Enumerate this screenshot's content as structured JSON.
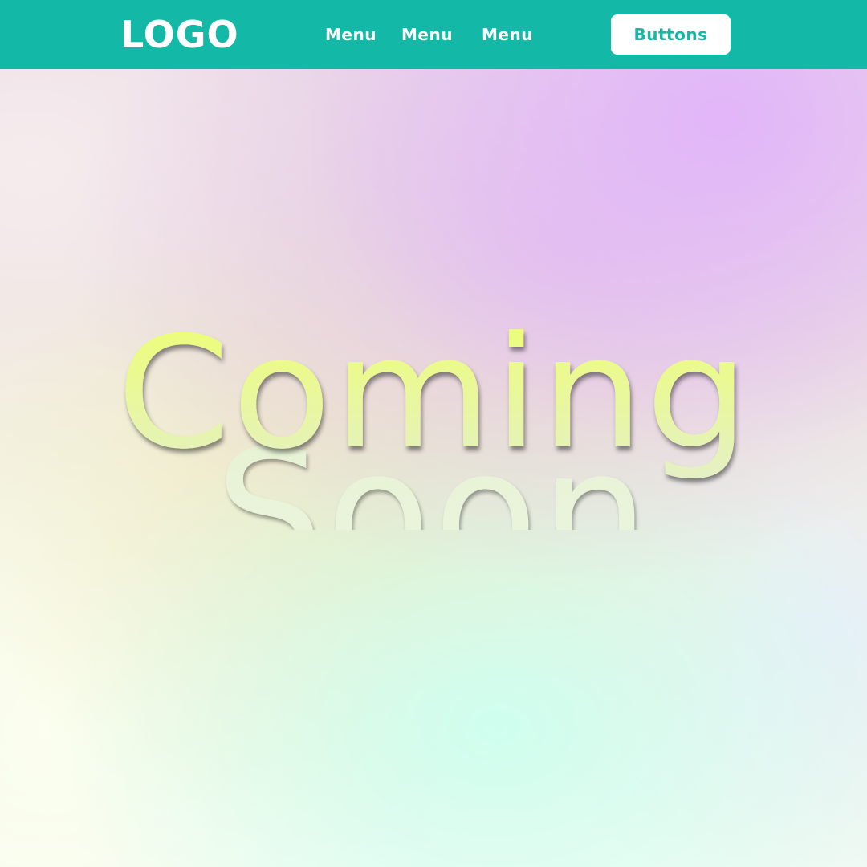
{
  "header": {
    "logo": "LOGO",
    "menu": [
      "Menu",
      "Menu",
      "Menu"
    ],
    "button_label": "Buttons"
  },
  "hero": {
    "headline_line1": "Coming",
    "headline_line2": "Soon"
  },
  "colors": {
    "brand": "#14b8a6",
    "button_bg": "#ffffff",
    "headline_top": "#eeff77",
    "headline_bottom": "#e2eed8",
    "text_light": "#ffffff"
  }
}
